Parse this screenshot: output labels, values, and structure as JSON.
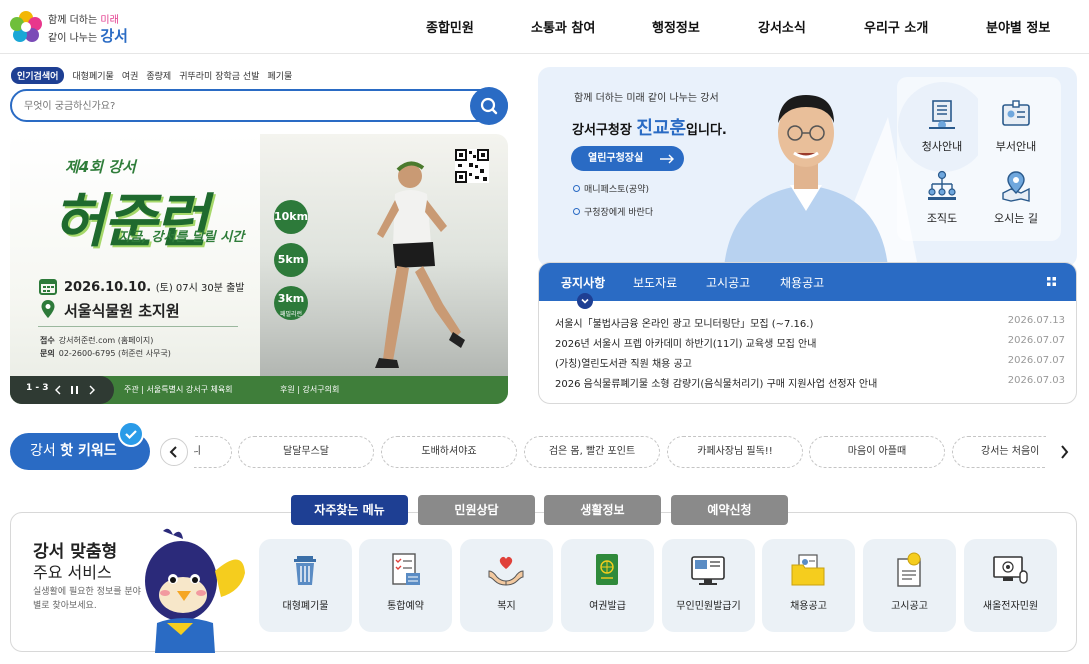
{
  "header": {
    "logo_line1": "함께 더하는",
    "logo_line1_accent": "미래",
    "logo_line2": "같이 나누는",
    "logo_line2_brand": "강서",
    "nav": [
      "종합민원",
      "소통과 참여",
      "행정정보",
      "강서소식",
      "우리구 소개",
      "분야별 정보"
    ]
  },
  "search": {
    "popular_label": "인기검색어",
    "popular_terms": [
      "대형폐기물",
      "여권",
      "종량제",
      "귀뚜라미 장학금 선발",
      "폐기물"
    ],
    "placeholder": "무엇이 궁금하신가요?",
    "button_icon": "search-icon"
  },
  "banner": {
    "edition": "제4회 강서",
    "title": "허준런",
    "subtitle": "지금, 강서를 달릴 시간",
    "date": "2026.10.10.",
    "date_detail": "(토) 07시 30분 출발",
    "place": "서울식물원 초지원",
    "apply_label": "접수",
    "apply_value": "강서허준런.com (홈페이지)",
    "contact_label": "문의",
    "contact_value": "02-2600-6795 (허준런 사무국)",
    "km": [
      "10km",
      "5km",
      "3km"
    ],
    "km_sub": "패밀리런",
    "pager": "1 - 3",
    "host": "주관 | 서울특별시 강서구 체육회",
    "sponsor": "후원 | 강서구의회"
  },
  "mayor": {
    "greeting": "함께 더하는 미래 같이 나누는 강서",
    "title_prefix": "강서구청장",
    "name": "진교훈",
    "title_suffix": "입니다.",
    "button": "열린구청장실",
    "links": [
      "매니페스토(공약)",
      "구청장에게 바란다"
    ],
    "quick": [
      {
        "label": "청사안내",
        "icon": "building-icon"
      },
      {
        "label": "부서안내",
        "icon": "id-card-icon"
      },
      {
        "label": "조직도",
        "icon": "org-chart-icon"
      },
      {
        "label": "오시는 길",
        "icon": "map-pin-icon"
      }
    ]
  },
  "notice": {
    "tabs": [
      "공지사항",
      "보도자료",
      "고시공고",
      "채용공고"
    ],
    "items": [
      {
        "title": "서울시「불법사금융 온라인 광고 모니터링단」모집 (~7.16.)",
        "date": "2026.07.13"
      },
      {
        "title": "2026년 서울시 프렙 아카데미 하반기(11기) 교육생 모집 안내",
        "date": "2026.07.07"
      },
      {
        "title": "(가칭)열린도서관 직원 채용 공고",
        "date": "2026.07.07"
      },
      {
        "title": "2026 음식물류폐기물 소형 감량기(음식물처리기) 구매 지원사업 선정자 안내",
        "date": "2026.07.03"
      }
    ]
  },
  "keywords": {
    "label_prefix": "강서",
    "label_bold": "핫 키워드",
    "items": [
      "니",
      "달달무스달",
      "도배하셔야죠",
      "검은 몸, 빨간 포인트",
      "카페사장님 필독!!",
      "마음이 아플때",
      "강서는 처음이"
    ]
  },
  "services": {
    "tabs": [
      "자주찾는 메뉴",
      "민원상담",
      "생활정보",
      "예약신청"
    ],
    "heading1": "강서 맞춤형",
    "heading2": "주요 서비스",
    "desc": "실생활에 필요한 정보를 분야별로 찾아보세요.",
    "items": [
      {
        "label": "대형폐기물",
        "icon": "trash-can-icon"
      },
      {
        "label": "통합예약",
        "icon": "checklist-icon"
      },
      {
        "label": "복지",
        "icon": "heart-hands-icon"
      },
      {
        "label": "여권발급",
        "icon": "passport-icon"
      },
      {
        "label": "무인민원발급기",
        "icon": "kiosk-icon"
      },
      {
        "label": "채용공고",
        "icon": "folder-icon"
      },
      {
        "label": "고시공고",
        "icon": "certificate-icon"
      },
      {
        "label": "새올전자민원",
        "icon": "computer-icon"
      }
    ]
  },
  "colors": {
    "primary": "#2a6bc4",
    "navy": "#1e3f93",
    "green": "#1f6a2e"
  }
}
